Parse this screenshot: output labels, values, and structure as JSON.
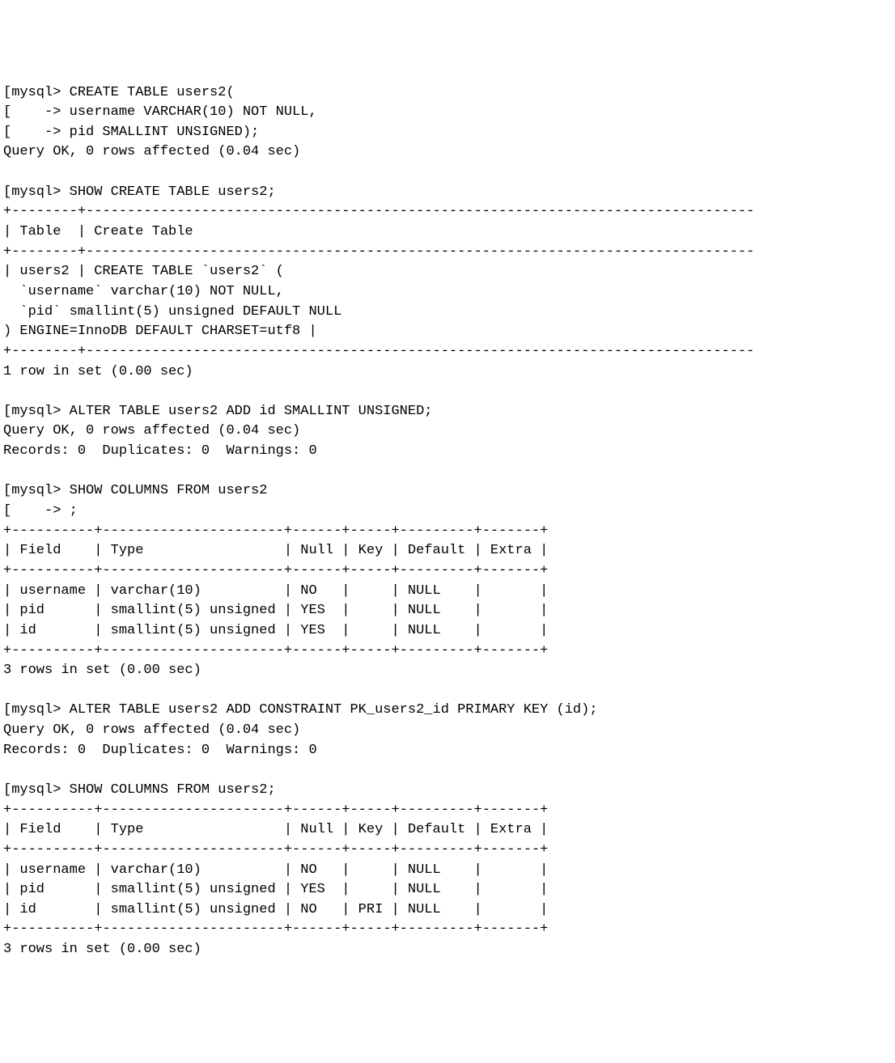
{
  "lines": [
    "[mysql> CREATE TABLE users2(",
    "[    -> username VARCHAR(10) NOT NULL,",
    "[    -> pid SMALLINT UNSIGNED);",
    "Query OK, 0 rows affected (0.04 sec)",
    "",
    "[mysql> SHOW CREATE TABLE users2;",
    "+--------+---------------------------------------------------------------------------------",
    "| Table  | Create Table",
    "+--------+---------------------------------------------------------------------------------",
    "| users2 | CREATE TABLE `users2` (",
    "  `username` varchar(10) NOT NULL,",
    "  `pid` smallint(5) unsigned DEFAULT NULL",
    ") ENGINE=InnoDB DEFAULT CHARSET=utf8 |",
    "+--------+---------------------------------------------------------------------------------",
    "1 row in set (0.00 sec)",
    "",
    "[mysql> ALTER TABLE users2 ADD id SMALLINT UNSIGNED;",
    "Query OK, 0 rows affected (0.04 sec)",
    "Records: 0  Duplicates: 0  Warnings: 0",
    "",
    "[mysql> SHOW COLUMNS FROM users2",
    "[    -> ;",
    "+----------+----------------------+------+-----+---------+-------+",
    "| Field    | Type                 | Null | Key | Default | Extra |",
    "+----------+----------------------+------+-----+---------+-------+",
    "| username | varchar(10)          | NO   |     | NULL    |       |",
    "| pid      | smallint(5) unsigned | YES  |     | NULL    |       |",
    "| id       | smallint(5) unsigned | YES  |     | NULL    |       |",
    "+----------+----------------------+------+-----+---------+-------+",
    "3 rows in set (0.00 sec)",
    "",
    "[mysql> ALTER TABLE users2 ADD CONSTRAINT PK_users2_id PRIMARY KEY (id);",
    "Query OK, 0 rows affected (0.04 sec)",
    "Records: 0  Duplicates: 0  Warnings: 0",
    "",
    "[mysql> SHOW COLUMNS FROM users2;",
    "+----------+----------------------+------+-----+---------+-------+",
    "| Field    | Type                 | Null | Key | Default | Extra |",
    "+----------+----------------------+------+-----+---------+-------+",
    "| username | varchar(10)          | NO   |     | NULL    |       |",
    "| pid      | smallint(5) unsigned | YES  |     | NULL    |       |",
    "| id       | smallint(5) unsigned | NO   | PRI | NULL    |       |",
    "+----------+----------------------+------+-----+---------+-------+",
    "3 rows in set (0.00 sec)"
  ],
  "commands": {
    "create_table": "CREATE TABLE users2( username VARCHAR(10) NOT NULL, pid SMALLINT UNSIGNED);",
    "show_create": "SHOW CREATE TABLE users2;",
    "alter_add_id": "ALTER TABLE users2 ADD id SMALLINT UNSIGNED;",
    "show_columns_1": "SHOW COLUMNS FROM users2;",
    "alter_add_pk": "ALTER TABLE users2 ADD CONSTRAINT PK_users2_id PRIMARY KEY (id);",
    "show_columns_2": "SHOW COLUMNS FROM users2;"
  },
  "results": {
    "create_ok": "Query OK, 0 rows affected (0.04 sec)",
    "show_create_table": {
      "table": "users2",
      "create_table": "CREATE TABLE `users2` ( `username` varchar(10) NOT NULL, `pid` smallint(5) unsigned DEFAULT NULL ) ENGINE=InnoDB DEFAULT CHARSET=utf8",
      "rows_in_set": "1 row in set (0.00 sec)"
    },
    "alter_ok": "Query OK, 0 rows affected (0.04 sec)",
    "alter_records": "Records: 0  Duplicates: 0  Warnings: 0",
    "columns_before_pk": {
      "headers": [
        "Field",
        "Type",
        "Null",
        "Key",
        "Default",
        "Extra"
      ],
      "rows": [
        {
          "Field": "username",
          "Type": "varchar(10)",
          "Null": "NO",
          "Key": "",
          "Default": "NULL",
          "Extra": ""
        },
        {
          "Field": "pid",
          "Type": "smallint(5) unsigned",
          "Null": "YES",
          "Key": "",
          "Default": "NULL",
          "Extra": ""
        },
        {
          "Field": "id",
          "Type": "smallint(5) unsigned",
          "Null": "YES",
          "Key": "",
          "Default": "NULL",
          "Extra": ""
        }
      ],
      "count": "3 rows in set (0.00 sec)"
    },
    "columns_after_pk": {
      "headers": [
        "Field",
        "Type",
        "Null",
        "Key",
        "Default",
        "Extra"
      ],
      "rows": [
        {
          "Field": "username",
          "Type": "varchar(10)",
          "Null": "NO",
          "Key": "",
          "Default": "NULL",
          "Extra": ""
        },
        {
          "Field": "pid",
          "Type": "smallint(5) unsigned",
          "Null": "YES",
          "Key": "",
          "Default": "NULL",
          "Extra": ""
        },
        {
          "Field": "id",
          "Type": "smallint(5) unsigned",
          "Null": "NO",
          "Key": "PRI",
          "Default": "NULL",
          "Extra": ""
        }
      ],
      "count": "3 rows in set (0.00 sec)"
    }
  }
}
